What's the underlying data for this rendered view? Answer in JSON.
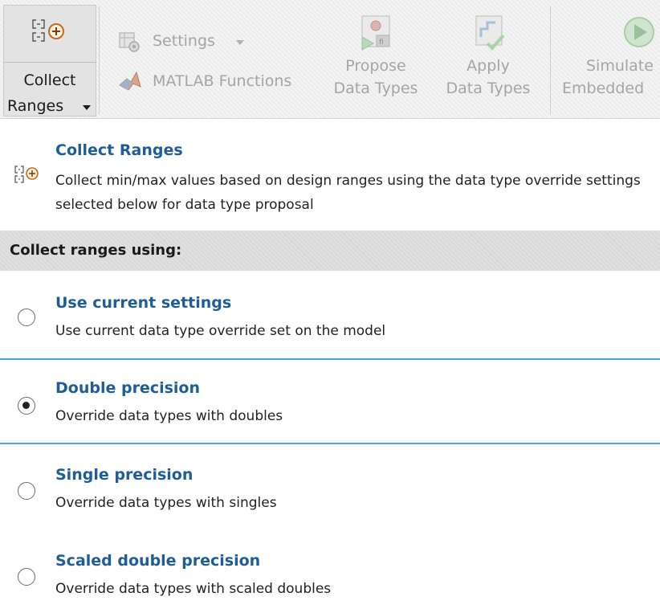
{
  "toolstrip": {
    "collect": {
      "label_line1": "Collect",
      "label_line2": "Ranges"
    },
    "settings_label": "Settings",
    "matlab_functions_label": "MATLAB Functions",
    "propose": {
      "line1": "Propose",
      "line2": "Data Types"
    },
    "apply": {
      "line1": "Apply",
      "line2": "Data Types"
    },
    "simulate": {
      "line1": "Simulate",
      "line2": "Embedded"
    }
  },
  "description": {
    "title": "Collect Ranges",
    "text": "Collect min/max values based on design ranges using the data type override settings selected below for data type proposal"
  },
  "section": {
    "header": "Collect ranges using:"
  },
  "options": [
    {
      "title": "Use current settings",
      "description": "Use current data type override set on the model",
      "selected": false
    },
    {
      "title": "Double precision",
      "description": "Override data types with doubles",
      "selected": true
    },
    {
      "title": "Single precision",
      "description": "Override data types with singles",
      "selected": false
    },
    {
      "title": "Scaled double precision",
      "description": "Override data types with scaled doubles",
      "selected": false
    }
  ],
  "colors": {
    "accent_title": "#1e5d96",
    "divider": "#4aa3dd",
    "disabled_text": "#a5a5a5"
  },
  "icons": {
    "collect": "collect-ranges-icon",
    "settings": "settings-icon",
    "matlab": "matlab-icon",
    "propose": "propose-data-types-icon",
    "apply": "apply-data-types-icon",
    "simulate": "simulate-embedded-icon"
  }
}
